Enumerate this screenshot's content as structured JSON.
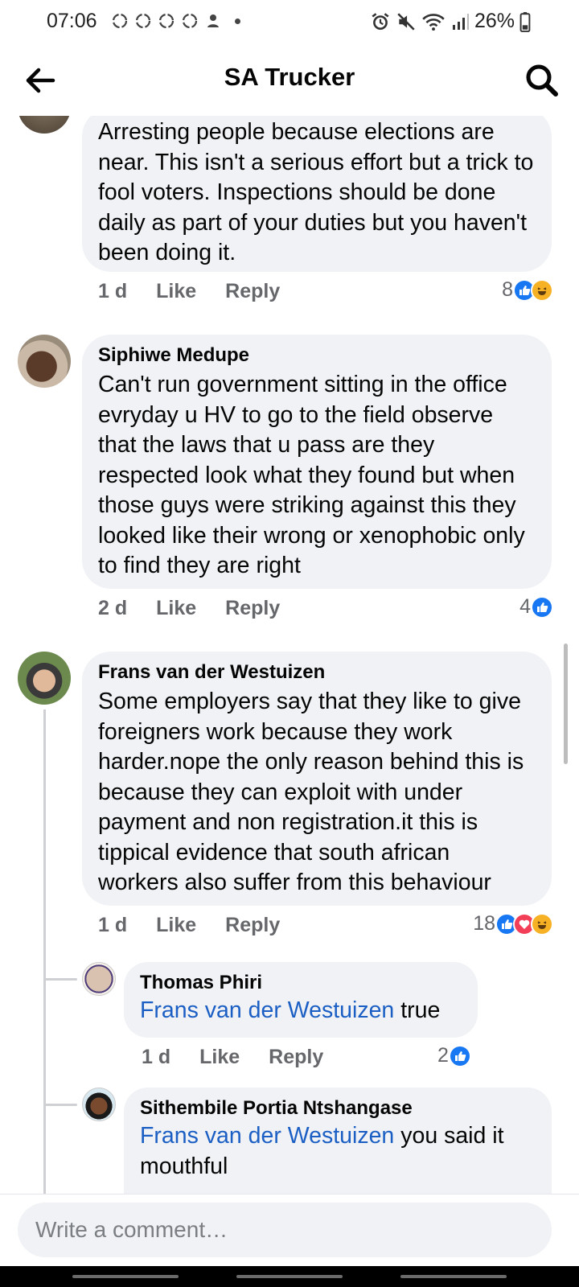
{
  "status_bar": {
    "time": "07:06",
    "battery": "26%"
  },
  "header": {
    "title": "SA Trucker"
  },
  "comments": [
    {
      "text": "Arresting people because elections are near. This isn't a serious effort but a trick to fool voters. Inspections should be done daily as part of your duties but you haven't been doing it.",
      "time": "1 d",
      "like": "Like",
      "reply": "Reply",
      "reaction_count": "8"
    },
    {
      "author": "Siphiwe Medupe",
      "text": "Can't run government sitting in the office evryday u HV to go to the field observe that the laws that u pass are they respected look what they found but when those guys were striking against this they looked like their wrong or xenophobic only to find they are right",
      "time": "2 d",
      "like": "Like",
      "reply": "Reply",
      "reaction_count": "4"
    },
    {
      "author": "Frans van der Westuizen",
      "text": "Some employers say that they like to give foreigners  work because they work harder.nope the only reason behind this is because they can exploit with under payment and non registration.it this is tippical evidence  that south african workers also suffer from this behaviour",
      "time": "1 d",
      "like": "Like",
      "reply": "Reply",
      "reaction_count": "18"
    }
  ],
  "replies": [
    {
      "author": "Thomas Phiri",
      "mention": "Frans van der Westuizen",
      "text": " true",
      "time": "1 d",
      "like": "Like",
      "reply": "Reply",
      "reaction_count": "2"
    },
    {
      "author": "Sithembile Portia Ntshangase",
      "mention": "Frans van der Westuizen",
      "text": " you said it mouthful"
    }
  ],
  "composer": {
    "placeholder": "Write a comment…"
  },
  "colors": {
    "bubble": "#f0f2f5",
    "link": "#1b5fc4",
    "like_blue": "#1877f2",
    "love_red": "#f33e58",
    "haha_yellow": "#f7b125"
  },
  "icons": [
    "arrow-left-icon",
    "search-icon",
    "like-reaction-icon",
    "love-reaction-icon",
    "haha-reaction-icon",
    "alarm-icon",
    "mute-icon",
    "wifi-icon",
    "signal-icon",
    "battery-icon"
  ]
}
